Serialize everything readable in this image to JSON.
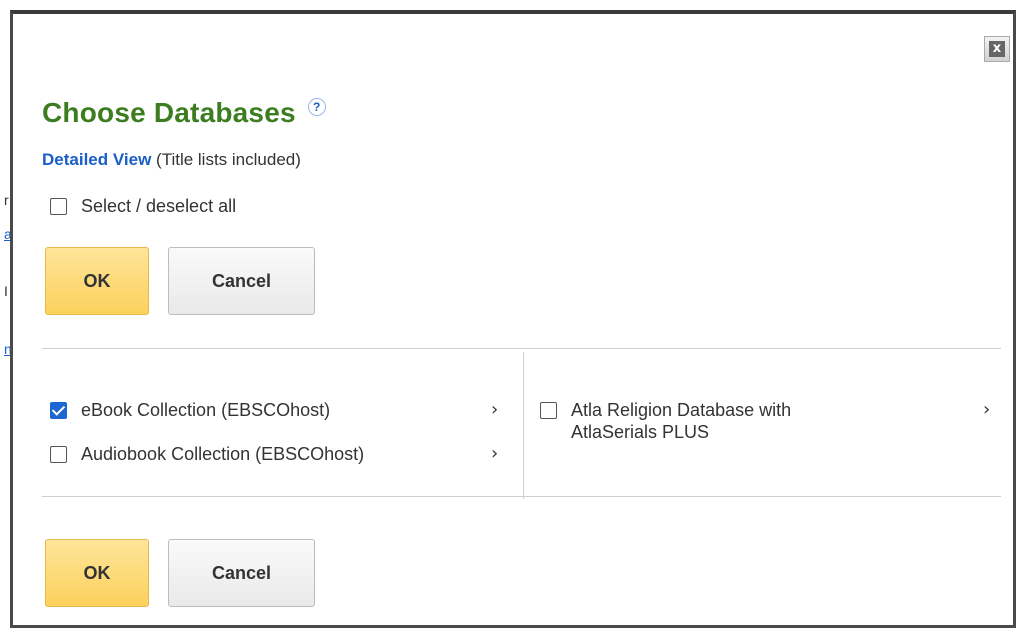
{
  "dialog": {
    "title": "Choose Databases",
    "help_icon": "?",
    "close_icon": "x",
    "detailed_view_link": "Detailed View",
    "detailed_view_note": "(Title lists included)",
    "select_all_label": "Select / deselect all",
    "select_all_checked": false,
    "ok_label": "OK",
    "cancel_label": "Cancel",
    "databases": [
      {
        "label": "eBook Collection (EBSCOhost)",
        "checked": true
      },
      {
        "label": "Audiobook Collection (EBSCOhost)",
        "checked": false
      },
      {
        "label": "Atla Religion Database with AtlaSerials PLUS",
        "checked": false
      }
    ],
    "chevron": "›"
  },
  "colors": {
    "title": "#3c7d20",
    "link": "#1a5ec8",
    "ok_button": "#fcd15c",
    "checkbox_checked": "#1a66d2"
  },
  "background_fragments": [
    "r",
    "a",
    "I",
    "n"
  ]
}
